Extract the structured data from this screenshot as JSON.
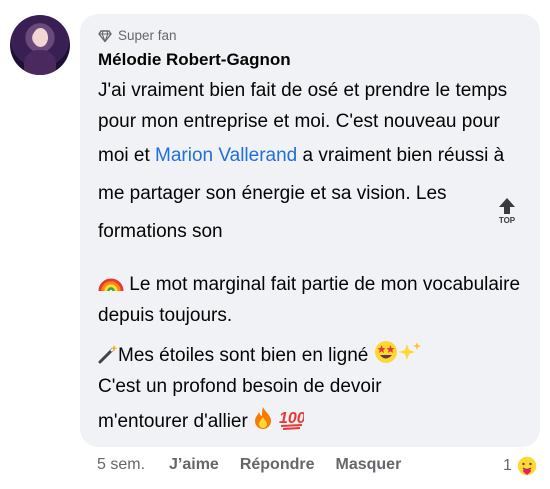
{
  "comment": {
    "badge": "Super fan",
    "author": "Mélodie Robert-Gagnon",
    "paragraph1_before": "J'ai vraiment bien fait de osé et prendre le temps pour mon entreprise et moi. C'est nouveau pour moi et ",
    "mention": "Marion Vallerand",
    "paragraph1_after": " a vraiment bien réussi à me partager son énergie et sa vision. Les formations son",
    "paragraph2": "Le mot marginal fait partie de mon vocabulaire depuis toujours.",
    "paragraph3_line1": "Mes étoiles sont bien en ligné",
    "paragraph3_line2": "C'est un profond besoin de devoir",
    "paragraph3_line3": "m'entourer d'allier"
  },
  "actions": {
    "time": "5 sem.",
    "like": "J’aime",
    "reply": "Répondre",
    "hide": "Masquer"
  },
  "reactions": {
    "count": "1"
  },
  "colors": {
    "bubble": "#f0f2f5",
    "mention": "#216fdb",
    "meta": "#65676b"
  },
  "top_icon_label": "TOP"
}
